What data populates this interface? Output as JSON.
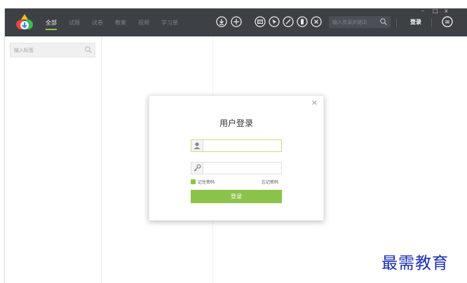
{
  "nav": {
    "items": [
      {
        "label": "全部",
        "active": true
      },
      {
        "label": "试题",
        "active": false
      },
      {
        "label": "试卷",
        "active": false
      },
      {
        "label": "教案",
        "active": false
      },
      {
        "label": "视频",
        "active": false
      },
      {
        "label": "学习单",
        "active": false
      }
    ]
  },
  "toolbar": {
    "left_icons": [
      "download-icon",
      "add-icon"
    ],
    "right_icons": [
      "message-icon",
      "pointer-icon",
      "pen-icon",
      "eraser-icon",
      "clear-icon"
    ]
  },
  "search": {
    "placeholder": "输入资源关键词"
  },
  "header": {
    "login_label": "登录",
    "message_icon": "chat-icon"
  },
  "window": {
    "minimize": "–",
    "maximize": "□",
    "close": "x"
  },
  "sidebar": {
    "tag_search_placeholder": "输入标签"
  },
  "modal": {
    "close": "×",
    "title": "用户登录",
    "remember_label": "记住密码",
    "forgot_label": "忘记密码",
    "submit_label": "登录"
  },
  "watermark": {
    "text": "最需教育"
  },
  "colors": {
    "titlebar": "#3d4045",
    "accent": "#8bc34a",
    "watermark": "#1a2cae"
  }
}
